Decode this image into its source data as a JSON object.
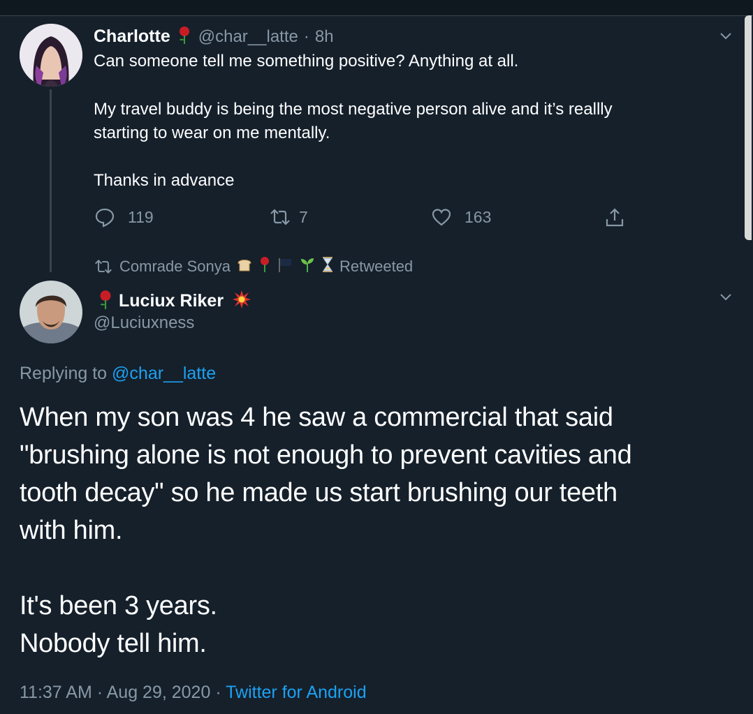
{
  "tweet1": {
    "name": "Charlotte",
    "handle": "@char__latte",
    "sep": "·",
    "time": "8h",
    "lines": [
      "Can someone tell me something positive? Anything at all.",
      "My travel buddy is being the most negative person alive and it’s reallly",
      "starting to wear on me mentally.",
      "Thanks in advance"
    ],
    "replies": "119",
    "retweets": "7",
    "likes": "163"
  },
  "retweet_bar": {
    "name": "Comrade Sonya",
    "label": "Retweeted"
  },
  "tweet2": {
    "name": "Luciux Riker",
    "handle": "@Luciuxness",
    "replying_prefix": "Replying to",
    "replying_handle": "@char__latte",
    "body": [
      "When my son was 4 he saw a commercial that said",
      "\"brushing alone is not enough to prevent cavities and",
      "tooth decay\" so he made us start brushing our teeth",
      "with him.",
      "It's been 3 years.",
      "Nobody tell him."
    ],
    "timestamp": "11:37 AM · Aug 29, 2020",
    "dot": "·",
    "source": "Twitter for Android"
  },
  "colors": {
    "background": "#15202b",
    "muted": "#8899a6",
    "accent": "#1da1f2"
  }
}
